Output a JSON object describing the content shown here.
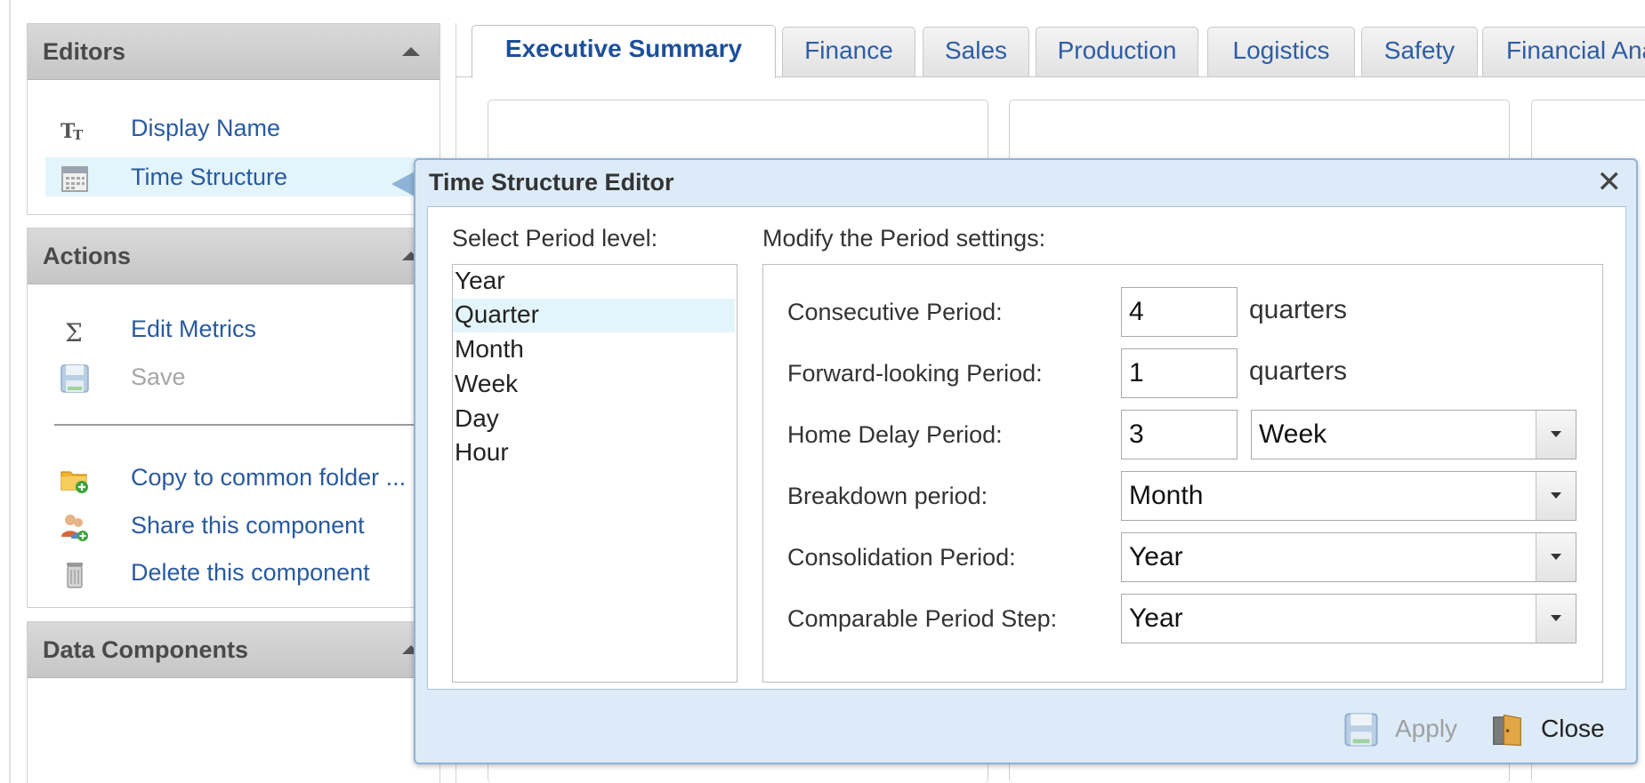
{
  "editors": {
    "title": "Editors",
    "items": [
      {
        "label": "Display Name",
        "icon": "text-size-icon"
      },
      {
        "label": "Time Structure",
        "icon": "calendar-icon",
        "selected": true
      }
    ]
  },
  "actions": {
    "title": "Actions",
    "items": [
      {
        "label": "Edit Metrics",
        "icon": "sigma-icon"
      },
      {
        "label": "Save",
        "icon": "floppy-disk-icon",
        "disabled": true
      },
      {
        "label": "Copy to common folder ...",
        "icon": "folder-add-icon"
      },
      {
        "label": "Share this component",
        "icon": "users-add-icon"
      },
      {
        "label": "Delete this component",
        "icon": "trash-icon"
      }
    ]
  },
  "data_components": {
    "title": "Data Components"
  },
  "tabs": [
    {
      "label": "Executive Summary",
      "active": true
    },
    {
      "label": "Finance"
    },
    {
      "label": "Sales"
    },
    {
      "label": "Production"
    },
    {
      "label": "Logistics"
    },
    {
      "label": "Safety"
    },
    {
      "label": "Financial Ana"
    }
  ],
  "dialog": {
    "title": "Time Structure Editor",
    "close_glyph": "✕",
    "select_period_label": "Select Period level:",
    "modify_label": "Modify the Period settings:",
    "period_levels": [
      "Year",
      "Quarter",
      "Month",
      "Week",
      "Day",
      "Hour"
    ],
    "selected_level": "Quarter",
    "fields": {
      "consecutive": {
        "label": "Consecutive Period:",
        "value": "4",
        "unit": "quarters"
      },
      "forward": {
        "label": "Forward-looking Period:",
        "value": "1",
        "unit": "quarters"
      },
      "home_delay": {
        "label": "Home Delay Period:",
        "value": "3",
        "select": "Week"
      },
      "breakdown": {
        "label": "Breakdown period:",
        "select": "Month"
      },
      "consolidation": {
        "label": "Consolidation Period:",
        "select": "Year"
      },
      "comparable": {
        "label": "Comparable Period Step:",
        "select": "Year"
      }
    },
    "apply_label": "Apply",
    "close_label": "Close"
  },
  "colors": {
    "link": "#2a5a9e",
    "dialog_bg": "#dcebf7",
    "dialog_border": "#8fb3d6",
    "selection": "#e3f5fb"
  }
}
